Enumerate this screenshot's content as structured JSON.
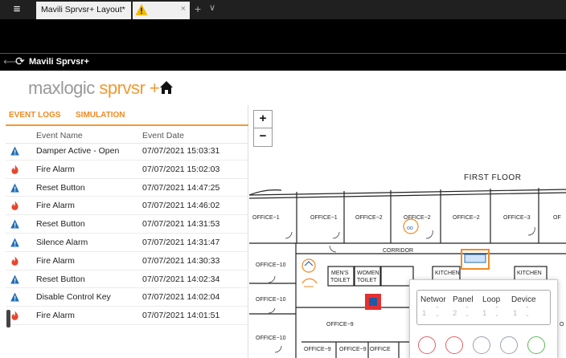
{
  "window": {
    "menu_icon": "hamburger-menu-icon",
    "tab_title": "Mavili Sprvsr+ Layout*",
    "warning_icon": "warning-icon",
    "close_glyph": "×",
    "add_glyph": "+",
    "more_glyph": "∨"
  },
  "app": {
    "title": "Mavili Sprvsr+",
    "logo_part1": "maxlogic",
    "logo_part2": " sprvsr +",
    "brand_color": "#f19a32"
  },
  "panel": {
    "tabs": [
      "EVENT LOGS",
      "SIMULATION"
    ],
    "columns": {
      "name": "Event Name",
      "date": "Event Date"
    },
    "rows": [
      {
        "icon": "info",
        "name": "Damper Active - Open",
        "date": "07/07/2021 15:03:31"
      },
      {
        "icon": "fire",
        "name": "Fire Alarm",
        "date": "07/07/2021 15:02:03"
      },
      {
        "icon": "info",
        "name": "Reset Button",
        "date": "07/07/2021 14:47:25"
      },
      {
        "icon": "fire",
        "name": "Fire Alarm",
        "date": "07/07/2021 14:46:02"
      },
      {
        "icon": "info",
        "name": "Reset Button",
        "date": "07/07/2021 14:31:53"
      },
      {
        "icon": "info",
        "name": "Silence Alarm",
        "date": "07/07/2021 14:31:47"
      },
      {
        "icon": "fire",
        "name": "Fire Alarm",
        "date": "07/07/2021 14:30:33"
      },
      {
        "icon": "info",
        "name": "Reset Button",
        "date": "07/07/2021 14:02:34"
      },
      {
        "icon": "info",
        "name": "Disable Control Key",
        "date": "07/07/2021 14:02:04"
      },
      {
        "icon": "fire",
        "name": "Fire Alarm",
        "date": "07/07/2021 14:01:51"
      }
    ]
  },
  "map": {
    "zoom_in": "+",
    "zoom_out": "−",
    "floor_title": "FIRST FLOOR",
    "rooms": {
      "office1a": "OFFICE−1",
      "office1b": "OFFICE−1",
      "office2a": "OFFICE−2",
      "office2b": "OFFICE−2",
      "office2c": "OFFICE−2",
      "office3": "OFFICE−3",
      "office_cut": "OF",
      "corridor": "CORRIDOR",
      "office10a": "OFFICE−10",
      "office10b": "OFFICE−10",
      "office10c": "OFFICE−10",
      "mens1": "MEN'S",
      "mens2": "TOILET",
      "womens1": "WOMEN",
      "womens2": "TOILET",
      "kitchen1": "KITCHEN",
      "kitchen2": "KITCHEN",
      "office9a": "OFFICE−9",
      "office9b": "OFFICE−9",
      "office9c": "OFFICE−9",
      "office_cut2": "OFFICE",
      "office_o": "O"
    },
    "popup": {
      "labels": [
        "Networ",
        "Panel",
        "Loop",
        "Device"
      ],
      "values": [
        "1",
        "2",
        "1",
        "1"
      ],
      "circle_colors": [
        "#e0606a",
        "#e0606a",
        "#9aa2b0",
        "#9aa2b0",
        "#5cb85c"
      ]
    }
  }
}
